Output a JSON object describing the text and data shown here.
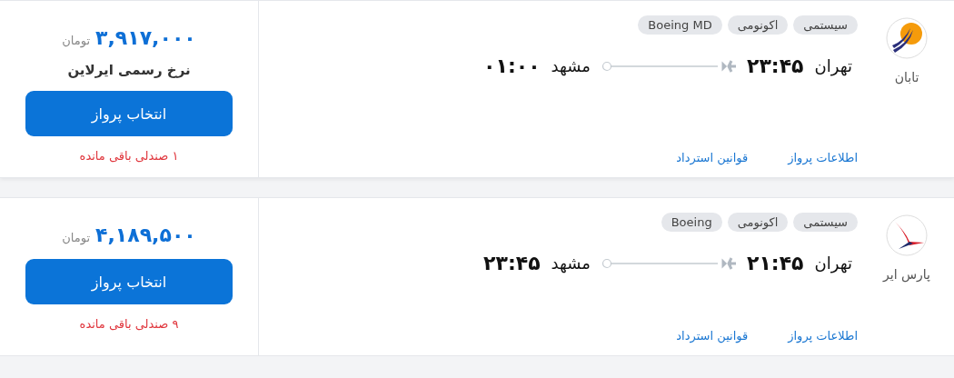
{
  "flights": [
    {
      "airline": "تابان",
      "tags": [
        "سیستمی",
        "اکونومی",
        "Boeing MD"
      ],
      "origin": "تهران",
      "departure": "۲۳:۴۵",
      "destination": "مشهد",
      "arrival": "۰۱:۰۰",
      "links": [
        "اطلاعات پرواز",
        "قوانین استرداد"
      ],
      "price": "۳,۹۱۷,۰۰۰",
      "currency": "تومان",
      "fare_note": "نرخ رسمی ایرلاین",
      "button": "انتخاب پرواز",
      "seats_left": "۱ صندلی باقی مانده"
    },
    {
      "airline": "پارس ایر",
      "tags": [
        "سیستمی",
        "اکونومی",
        "Boeing"
      ],
      "origin": "تهران",
      "departure": "۲۱:۴۵",
      "destination": "مشهد",
      "arrival": "۲۳:۴۵",
      "links": [
        "اطلاعات پرواز",
        "قوانین استرداد"
      ],
      "price": "۴,۱۸۹,۵۰۰",
      "currency": "تومان",
      "button": "انتخاب پرواز",
      "seats_left": "۹ صندلی باقی مانده"
    }
  ]
}
